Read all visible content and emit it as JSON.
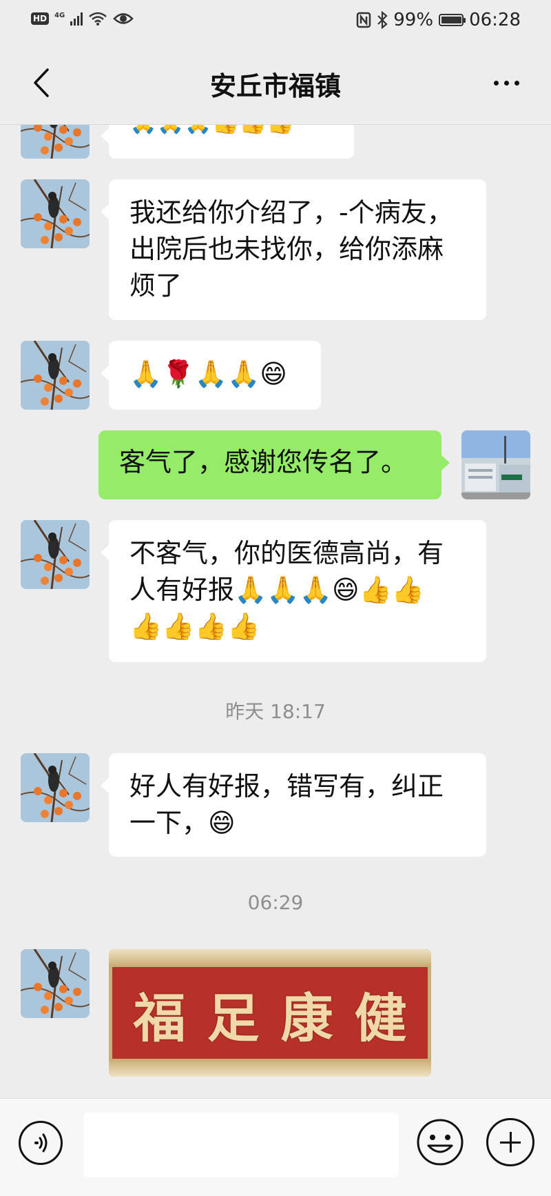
{
  "status_bar": {
    "network_badge": "HD",
    "network_type": "4G",
    "battery_percent": "99%",
    "time": "06:28",
    "icons": [
      "hd-icon",
      "signal-icon",
      "wifi-icon",
      "eye-icon",
      "nfc-icon",
      "bluetooth-icon",
      "battery-icon"
    ]
  },
  "header": {
    "title": "安丘市福镇",
    "back_icon": "back-arrow-icon",
    "more_icon": "more-icon"
  },
  "messages": [
    {
      "side": "left",
      "text": "🙏🙏🙏👍👍👍",
      "partial": true
    },
    {
      "side": "left",
      "lines": [
        "我还给你介绍了，-个病友，",
        "出院后也未找你，给你添麻",
        "烦了"
      ]
    },
    {
      "side": "left",
      "text": "🙏🌹🙏🙏😄"
    },
    {
      "side": "right",
      "text": "客气了，感谢您传名了。"
    },
    {
      "side": "left",
      "lines": [
        "不客气，你的医德高尚，有",
        "人有好报🙏🙏🙏😄👍👍",
        "👍👍👍👍"
      ]
    },
    {
      "type": "timestamp",
      "text": "昨天 18:17"
    },
    {
      "side": "left",
      "lines": [
        "好人有好报，错写有，纠正",
        "一下，😄"
      ]
    },
    {
      "type": "timestamp",
      "text": "06:29"
    },
    {
      "side": "left",
      "type": "image",
      "characters": [
        "福",
        "足",
        "康",
        "健"
      ]
    }
  ],
  "colors": {
    "background": "#ededed",
    "bubble_left": "#ffffff",
    "bubble_right": "#95ec69",
    "timestamp": "#8e8e8e"
  },
  "input_bar": {
    "placeholder": "",
    "voice_icon": "voice-icon",
    "emoji_icon": "emoji-icon",
    "plus_icon": "plus-icon"
  }
}
